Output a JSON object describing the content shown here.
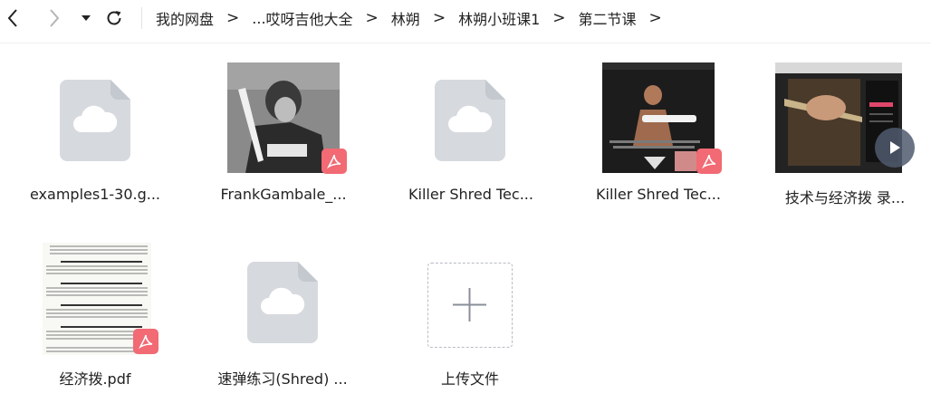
{
  "toolbar": {
    "back_icon": "chevron-left-icon",
    "forward_icon": "chevron-right-icon",
    "dropdown_icon": "caret-down-icon",
    "refresh_icon": "refresh-icon"
  },
  "breadcrumb": {
    "items": [
      "我的网盘",
      "...",
      "哎呀吉他大全",
      "林朔",
      "林朔小班课1",
      "第二节课"
    ],
    "separator": ">"
  },
  "files": [
    {
      "name": "examples1-30.g...",
      "type": "cloud-file"
    },
    {
      "name": "FrankGambale_...",
      "type": "pdf"
    },
    {
      "name": "Killer Shred Tec...",
      "type": "cloud-file"
    },
    {
      "name": "Killer Shred Tec...",
      "type": "pdf"
    },
    {
      "name": "技术与经济拨 录...",
      "type": "video"
    },
    {
      "name": "经济拨.pdf",
      "type": "pdf"
    },
    {
      "name": "速弹练习(Shred) ...",
      "type": "cloud-file"
    }
  ],
  "upload": {
    "label": "上传文件",
    "icon": "plus-icon"
  },
  "colors": {
    "pdf_badge": "#f16a74",
    "cloud_file_bg": "#d6d9de",
    "accent": "#222222"
  }
}
